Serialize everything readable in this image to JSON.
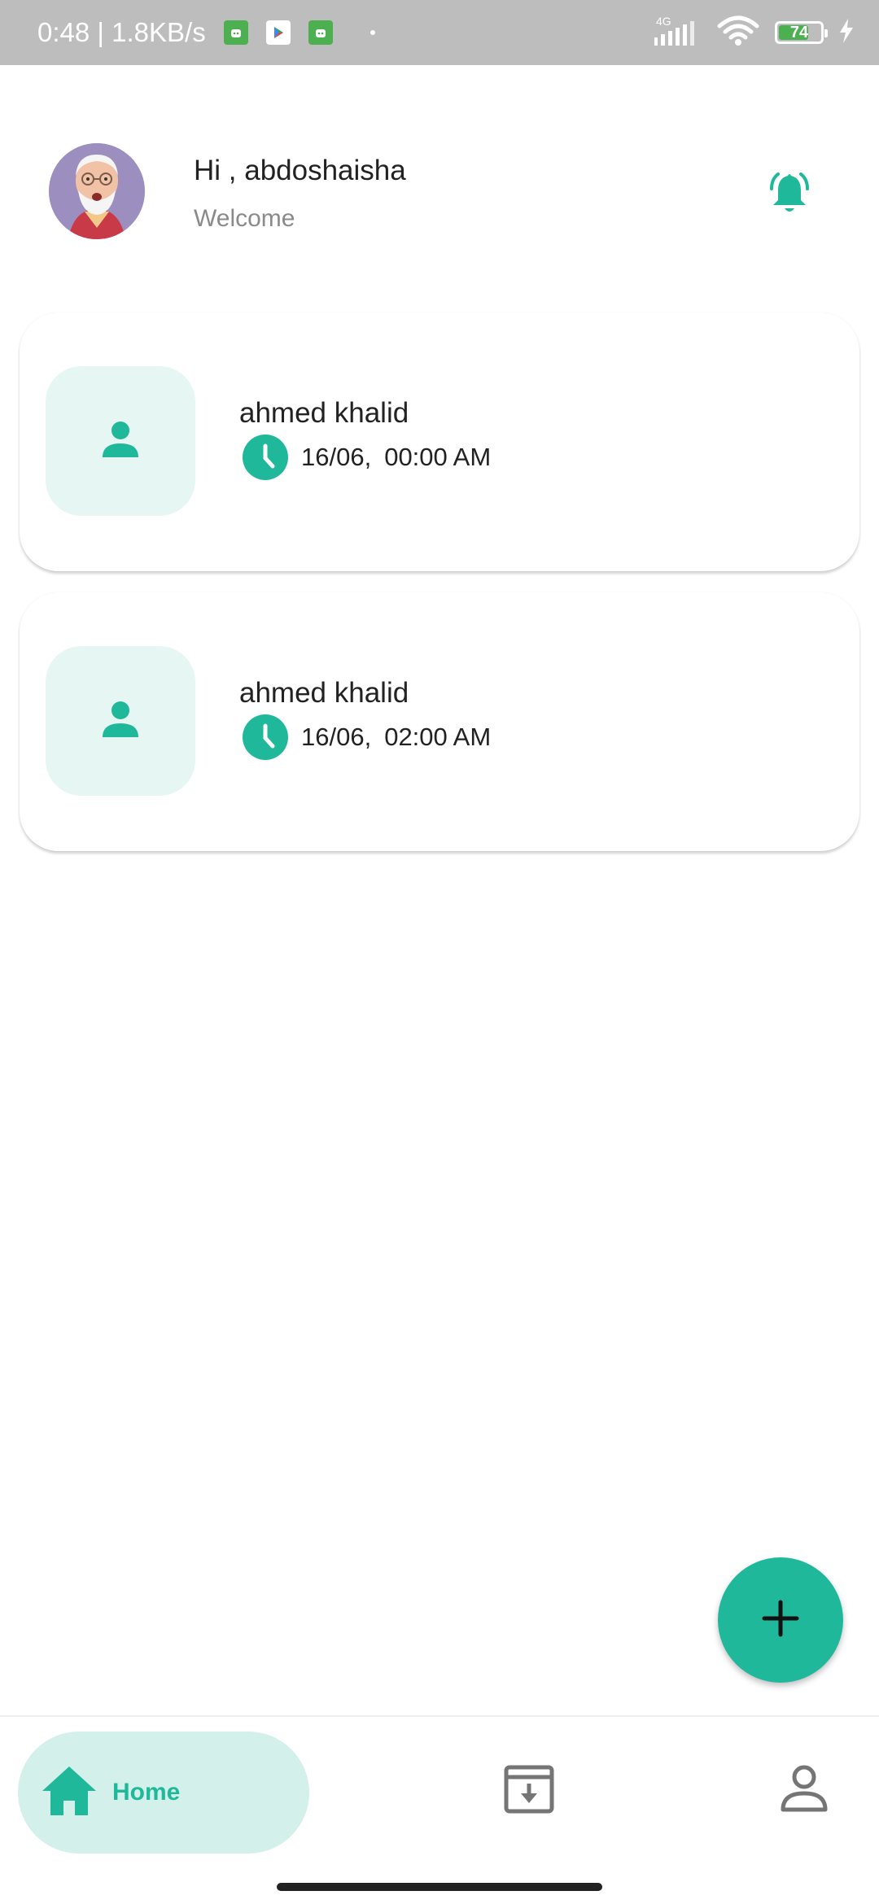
{
  "status_bar": {
    "time_speed": "0:48 | 1.8KB/s",
    "network_label": "4G",
    "battery_level": "74",
    "battery_fraction": 0.74
  },
  "header": {
    "greeting": "Hi , abdoshaisha",
    "subtitle": "Welcome"
  },
  "records": [
    {
      "name": "ahmed khalid",
      "date": "16/06,",
      "time": "00:00 AM"
    },
    {
      "name": "ahmed khalid",
      "date": "16/06,",
      "time": "02:00 AM"
    }
  ],
  "bottom_nav": {
    "home_label": "Home"
  },
  "colors": {
    "accent": "#20b89a",
    "accent_light": "#e6f6f2",
    "nav_active_bg": "#d3f0ea",
    "status_bar_bg": "#bdbdbd"
  },
  "icons": {
    "bell": "bell-ringing-icon",
    "person": "person-icon",
    "clock": "clock-icon",
    "fab": "plus-icon",
    "home": "home-icon",
    "archive": "archive-download-icon",
    "profile": "person-outline-icon"
  }
}
